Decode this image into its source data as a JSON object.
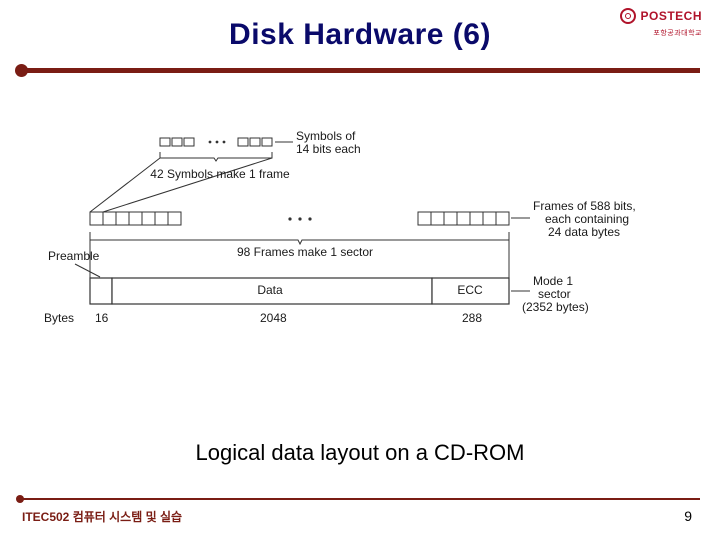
{
  "header": {
    "title": "Disk Hardware (6)",
    "brand": "POSTECH",
    "brand_sub": "포항공과대학교"
  },
  "footer": {
    "left": "ITEC502 컴퓨터 시스템 및 실습",
    "page": "9"
  },
  "caption": "Logical data layout on a CD-ROM",
  "diagram": {
    "symbols_label_l1": "Symbols of",
    "symbols_label_l2": "14 bits each",
    "frames_per_sector": "42 Symbols make 1 frame",
    "sectors_per_frame": "98 Frames make 1 sector",
    "frames_label_l1": "Frames of 588 bits,",
    "frames_label_l2": "each containing",
    "frames_label_l3": "24 data bytes",
    "preamble": "Preamble",
    "data": "Data",
    "ecc": "ECC",
    "mode1_l1": "Mode 1",
    "mode1_l2": "sector",
    "mode1_l3": "(2352 bytes)",
    "bytes_label": "Bytes",
    "bytes_preamble": "16",
    "bytes_data": "2048",
    "bytes_ecc": "288"
  }
}
